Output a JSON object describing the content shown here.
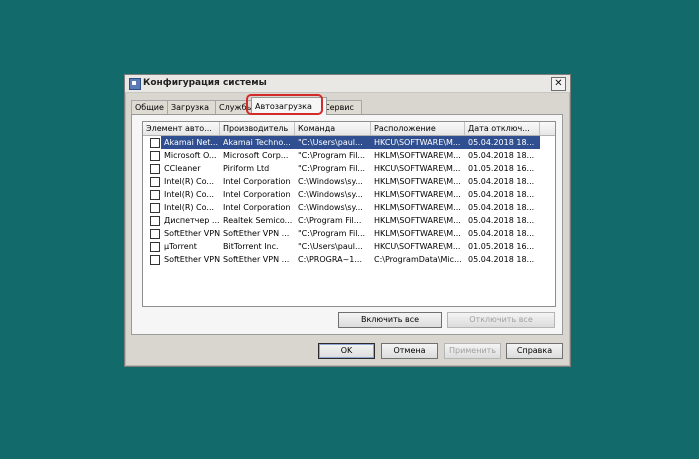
{
  "window": {
    "title": "Конфигурация системы",
    "close_glyph": "✕"
  },
  "tabs": [
    {
      "label": "Общие"
    },
    {
      "label": "Загрузка"
    },
    {
      "label": "Службы"
    },
    {
      "label": "Автозагрузка",
      "active": true
    },
    {
      "label": "Сервис"
    }
  ],
  "startup": {
    "columns": [
      "Элемент авто...",
      "Производитель",
      "Команда",
      "Расположение",
      "Дата отключ..."
    ],
    "rows": [
      {
        "item": "Akamai Net...",
        "maker": "Akamai Techno...",
        "command": "\"C:\\Users\\paul...",
        "location": "HKCU\\SOFTWARE\\M...",
        "date": "05.04.2018 18...",
        "selected": true
      },
      {
        "item": "Microsoft O...",
        "maker": "Microsoft Corp...",
        "command": "\"C:\\Program Fil...",
        "location": "HKLM\\SOFTWARE\\M...",
        "date": "05.04.2018 18..."
      },
      {
        "item": "CCleaner",
        "maker": "Piriform Ltd",
        "command": "\"C:\\Program Fil...",
        "location": "HKCU\\SOFTWARE\\M...",
        "date": "01.05.2018 16..."
      },
      {
        "item": "Intel(R) Co...",
        "maker": "Intel Corporation",
        "command": "C:\\Windows\\sy...",
        "location": "HKLM\\SOFTWARE\\M...",
        "date": "05.04.2018 18..."
      },
      {
        "item": "Intel(R) Co...",
        "maker": "Intel Corporation",
        "command": "C:\\Windows\\sy...",
        "location": "HKLM\\SOFTWARE\\M...",
        "date": "05.04.2018 18..."
      },
      {
        "item": "Intel(R) Co...",
        "maker": "Intel Corporation",
        "command": "C:\\Windows\\sy...",
        "location": "HKLM\\SOFTWARE\\M...",
        "date": "05.04.2018 18..."
      },
      {
        "item": "Диспетчер ...",
        "maker": "Realtek Semico...",
        "command": "C:\\Program Fil...",
        "location": "HKLM\\SOFTWARE\\M...",
        "date": "05.04.2018 18..."
      },
      {
        "item": "SoftEther VPN",
        "maker": "SoftEther VPN ...",
        "command": "\"C:\\Program Fil...",
        "location": "HKLM\\SOFTWARE\\M...",
        "date": "05.04.2018 18..."
      },
      {
        "item": "µTorrent",
        "maker": "BitTorrent Inc.",
        "command": "\"C:\\Users\\paul...",
        "location": "HKCU\\SOFTWARE\\M...",
        "date": "01.05.2018 16..."
      },
      {
        "item": "SoftEther VPN",
        "maker": "SoftEther VPN ...",
        "command": "C:\\PROGRA~1...",
        "location": "C:\\ProgramData\\Mic...",
        "date": "05.04.2018 18..."
      }
    ]
  },
  "panel_buttons": {
    "enable_all": "Включить все",
    "disable_all": "Отключить все"
  },
  "dialog_buttons": {
    "ok": "OK",
    "cancel": "Отмена",
    "apply": "Применить",
    "help": "Справка"
  },
  "colors": {
    "desktop": "#136a6a",
    "selection": "#2f4f90",
    "highlight_outline": "#d42a2a"
  }
}
